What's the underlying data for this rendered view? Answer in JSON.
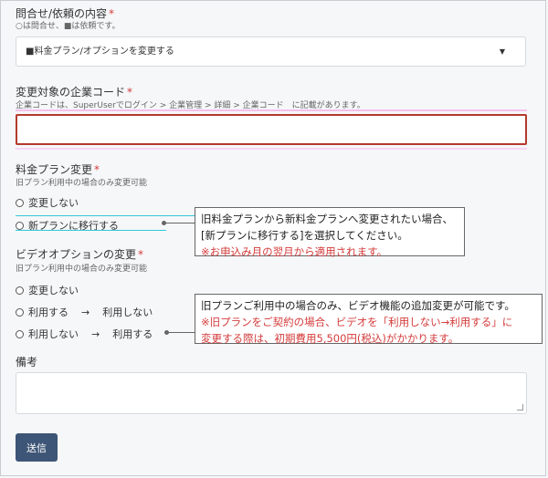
{
  "inquiry": {
    "label": "問合せ/依頼の内容",
    "required_mark": "*",
    "hint": "○は問合せ、■は依頼です。",
    "selected": "■料金プラン/オプションを変更する",
    "caret": "▼"
  },
  "company_code": {
    "label": "変更対象の企業コード",
    "required_mark": "*",
    "hint": "企業コードは、SuperUserでログイン > 企業管理 > 詳細 > 企業コード　に記載があります。",
    "value": ""
  },
  "plan_change": {
    "label": "料金プラン変更",
    "required_mark": "*",
    "hint": "旧プラン利用中の場合のみ変更可能",
    "options": [
      "変更しない",
      "新プランに移行する"
    ]
  },
  "plan_callout": {
    "line1": "旧料金プランから新料金プランへ変更されたい場合、",
    "line2": "[新プランに移行する]を選択してください。",
    "line3": "※お申込み月の翌月から適用されます。"
  },
  "video_option": {
    "label": "ビデオオプションの変更",
    "required_mark": "*",
    "hint": "旧プラン利用中の場合のみ変更可能",
    "option_none": "変更しない",
    "option_use_from": "利用する",
    "option_use_to": "利用しない",
    "option_nouse_from": "利用しない",
    "option_nouse_to": "利用する",
    "arrow": "→"
  },
  "video_callout": {
    "line1": "旧プランご利用中の場合のみ、ビデオ機能の追加変更が可能です。",
    "line2": "※旧プランをご契約の場合、ビデオを「利用しない→利用する」に",
    "line3": "変更する際は、初期費用5,500円(税込)がかかります。"
  },
  "remarks": {
    "label": "備考",
    "value": ""
  },
  "submit": {
    "label": "送信"
  },
  "colors": {
    "required": "#d43b3b",
    "error_border": "#b33a2c",
    "button": "#3d5576"
  }
}
